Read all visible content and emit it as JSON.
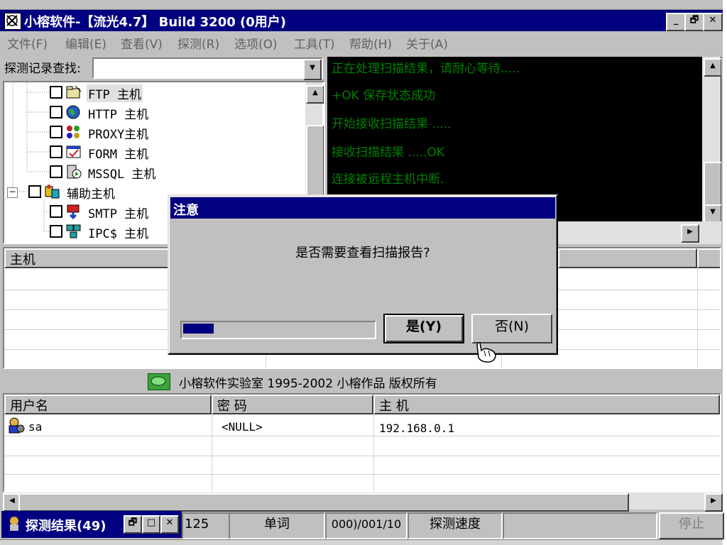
{
  "window": {
    "title": "小榕软件-【流光4.7】 Build 3200 (0用户)",
    "controls": [
      "_",
      "🗗",
      "✕"
    ]
  },
  "menu": [
    {
      "label": "文件(F)"
    },
    {
      "label": "编辑(E)"
    },
    {
      "label": "查看(V)"
    },
    {
      "label": "探测(R)"
    },
    {
      "label": "选项(O)"
    },
    {
      "label": "工具(T)"
    },
    {
      "label": "帮助(H)"
    },
    {
      "label": "关于(A)"
    }
  ],
  "search": {
    "label": "探测记录查找:",
    "value": ""
  },
  "tree": {
    "items": [
      {
        "label": "FTP  主机",
        "icon": "ftp-folder-icon"
      },
      {
        "label": "HTTP 主机",
        "icon": "globe-icon"
      },
      {
        "label": "PROXY主机",
        "icon": "proxy-icon"
      },
      {
        "label": "FORM 主机",
        "icon": "form-icon"
      },
      {
        "label": "MSSQL  主机",
        "icon": "database-icon"
      },
      {
        "label": "辅助主机",
        "icon": "group-icon"
      },
      {
        "label": "SMTP 主机",
        "icon": "mail-icon"
      },
      {
        "label": "IPC$ 主机",
        "icon": "network-icon"
      }
    ]
  },
  "log": [
    "正在处理扫描结果，请耐心等待.....",
    "+OK 保存状态成功",
    "开始接收扫描结果 .....",
    "接收扫描结果 .....OK",
    "连接被远程主机中断."
  ],
  "host_grid": {
    "header": "主机"
  },
  "copyright": "小榕软件实验室 1995-2002 小榕作品 版权所有",
  "user_grid": {
    "columns": [
      "用户名",
      "密  码",
      "主  机"
    ],
    "rows": [
      {
        "user": "sa",
        "password": "<NULL>",
        "host": "192.168.0.1"
      }
    ]
  },
  "status": {
    "result_tab": "探测结果(49)",
    "count": "125",
    "mode": "单词",
    "progress_text": "000)/001/10",
    "speed_label": "探测速度",
    "stop": "停止"
  },
  "dialog": {
    "title": "注意",
    "message": "是否需要查看扫描报告?",
    "yes_label": "是(Y)",
    "no_label": "否(N)",
    "progress": 0.16
  }
}
